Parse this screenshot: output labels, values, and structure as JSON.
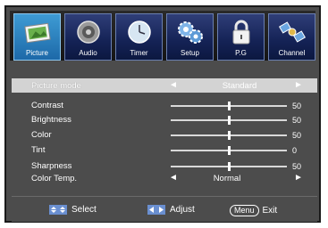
{
  "tabs": [
    {
      "label": "Picture",
      "icon": "picture-icon",
      "active": true
    },
    {
      "label": "Audio",
      "icon": "audio-icon",
      "active": false
    },
    {
      "label": "Timer",
      "icon": "timer-icon",
      "active": false
    },
    {
      "label": "Setup",
      "icon": "setup-icon",
      "active": false
    },
    {
      "label": "P.G",
      "icon": "lock-icon",
      "active": false
    },
    {
      "label": "Channel",
      "icon": "satellite-icon",
      "active": false
    }
  ],
  "menu": {
    "picture_mode": {
      "label": "Picture mode",
      "value": "Standard",
      "left_arrow": "◄",
      "right_arrow": "►"
    },
    "sliders": [
      {
        "label": "Contrast",
        "value": "50",
        "level": 0.5
      },
      {
        "label": "Brightness",
        "value": "50",
        "level": 0.5
      },
      {
        "label": "Color",
        "value": "50",
        "level": 0.5
      },
      {
        "label": "Tint",
        "value": "0",
        "level": 0.5
      },
      {
        "label": "Sharpness",
        "value": "50",
        "level": 0.5
      }
    ],
    "color_temp": {
      "label": "Color Temp.",
      "value": "Normal",
      "left_arrow": "◄",
      "right_arrow": "►"
    }
  },
  "footer": {
    "select_label": "Select",
    "adjust_label": "Adjust",
    "menu_key": "Menu",
    "exit_label": "Exit"
  },
  "colors": {
    "background": "#4c4c4c",
    "selected_row": "#d3d3d3",
    "active_tab": "#2f86c4",
    "inactive_tab": "#142255"
  }
}
